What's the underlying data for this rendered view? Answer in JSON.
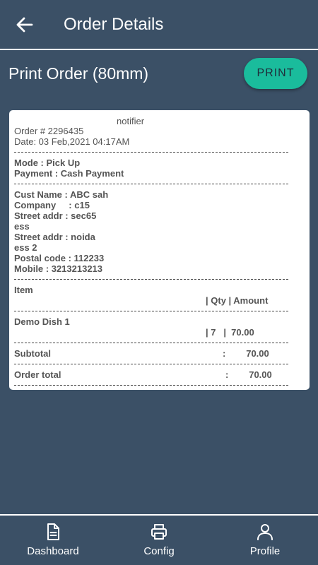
{
  "appbar": {
    "title": "Order Details",
    "back_icon": "arrow-left-icon"
  },
  "section": {
    "title": "Print Order (80mm)",
    "print_label": "PRINT"
  },
  "receipt": {
    "header": "notifier",
    "order_no": "Order # 2296435",
    "date": "Date: 03 Feb,2021 04:17AM",
    "mode": "Mode : Pick Up",
    "payment": "Payment : Cash Payment",
    "customer": {
      "name": "Cust Name : ABC sah",
      "company": "Company     : c15",
      "street1_a": "Street addr : sec65",
      "street1_b": "ess",
      "street2_a": "Street addr : noida",
      "street2_b": "ess 2",
      "postal": "Postal code : 112233",
      "mobile": "Mobile : 3213213213"
    },
    "items_header": {
      "item": "Item",
      "cols": "| Qty | Amount"
    },
    "items": [
      {
        "name": "Demo Dish 1",
        "qty_amount": "| 7   |  70.00"
      }
    ],
    "subtotal": {
      "label": "Subtotal",
      "value": ":        70.00"
    },
    "order_total": {
      "label": "Order total",
      "value": ":        70.00"
    }
  },
  "bottom_nav": [
    {
      "label": "Dashboard",
      "icon": "document-icon"
    },
    {
      "label": "Config",
      "icon": "printer-icon"
    },
    {
      "label": "Profile",
      "icon": "person-icon"
    }
  ],
  "colors": {
    "background": "#3b5066",
    "accent": "#1abc9c",
    "card": "#ffffff"
  }
}
